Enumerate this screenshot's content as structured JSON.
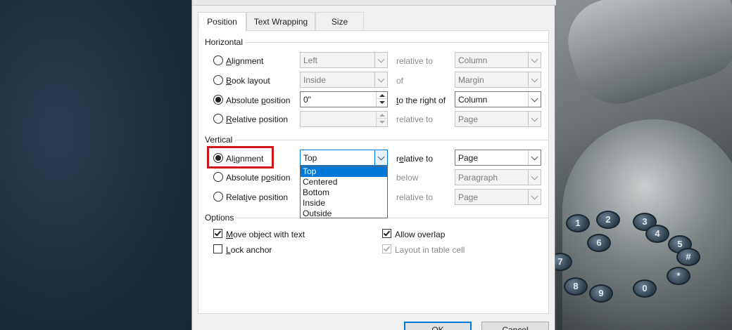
{
  "tabs": [
    {
      "label": "Position",
      "active": true
    },
    {
      "label": "Text Wrapping",
      "active": false
    },
    {
      "label": "Size",
      "active": false
    }
  ],
  "horizontal": {
    "title": "Horizontal",
    "alignment": {
      "label_u": "A",
      "label_rest": "lignment",
      "value": "Left",
      "rel_label": "relative to",
      "rel_value": "Column"
    },
    "book_layout": {
      "label_u": "B",
      "label_rest": "ook layout",
      "value": "Inside",
      "rel_label": "of",
      "rel_value": "Margin"
    },
    "absolute": {
      "label_pre": "Absolute ",
      "label_u": "p",
      "label_rest": "osition",
      "value": "0\"",
      "rel_u": "t",
      "rel_rest": "o the right of",
      "rel_value": "Column"
    },
    "relative": {
      "label_u": "R",
      "label_rest": "elative position",
      "value": "",
      "rel_label": "relative to",
      "rel_value": "Page"
    }
  },
  "vertical": {
    "title": "Vertical",
    "alignment": {
      "label_pre": "Al",
      "label_u": "i",
      "label_rest": "gnment",
      "value": "Top",
      "rel_pre": "r",
      "rel_u": "e",
      "rel_rest": "lative to",
      "rel_value": "Page"
    },
    "absolute": {
      "label_pre": "Absolute p",
      "label_u": "o",
      "label_rest": "sition",
      "rel_label": "below",
      "rel_value": "Paragraph"
    },
    "relative": {
      "label_pre": "Relat",
      "label_u": "i",
      "label_rest": "ve position",
      "rel_label": "relative to",
      "rel_value": "Page"
    },
    "dropdown_options": [
      "Top",
      "Centered",
      "Bottom",
      "Inside",
      "Outside"
    ],
    "dropdown_selected": "Top"
  },
  "options": {
    "title": "Options",
    "move_with_text": {
      "label_u": "M",
      "label_rest": "ove object with text",
      "checked": true
    },
    "lock_anchor": {
      "label_u": "L",
      "label_rest": "ock anchor",
      "checked": false
    },
    "allow_overlap": {
      "label": "Allow overlap",
      "checked": true
    },
    "layout_in_cell": {
      "label": "Layout in table cell",
      "checked": true
    }
  },
  "buttons": {
    "ok": "OK",
    "cancel": "Cancel"
  },
  "phone_keys": [
    "7",
    "8",
    "9",
    "0",
    "#",
    "*",
    "6",
    "5",
    "4",
    "3",
    "2",
    "1"
  ],
  "colors": {
    "accent": "#0078d7",
    "highlight": "#d0161b"
  }
}
